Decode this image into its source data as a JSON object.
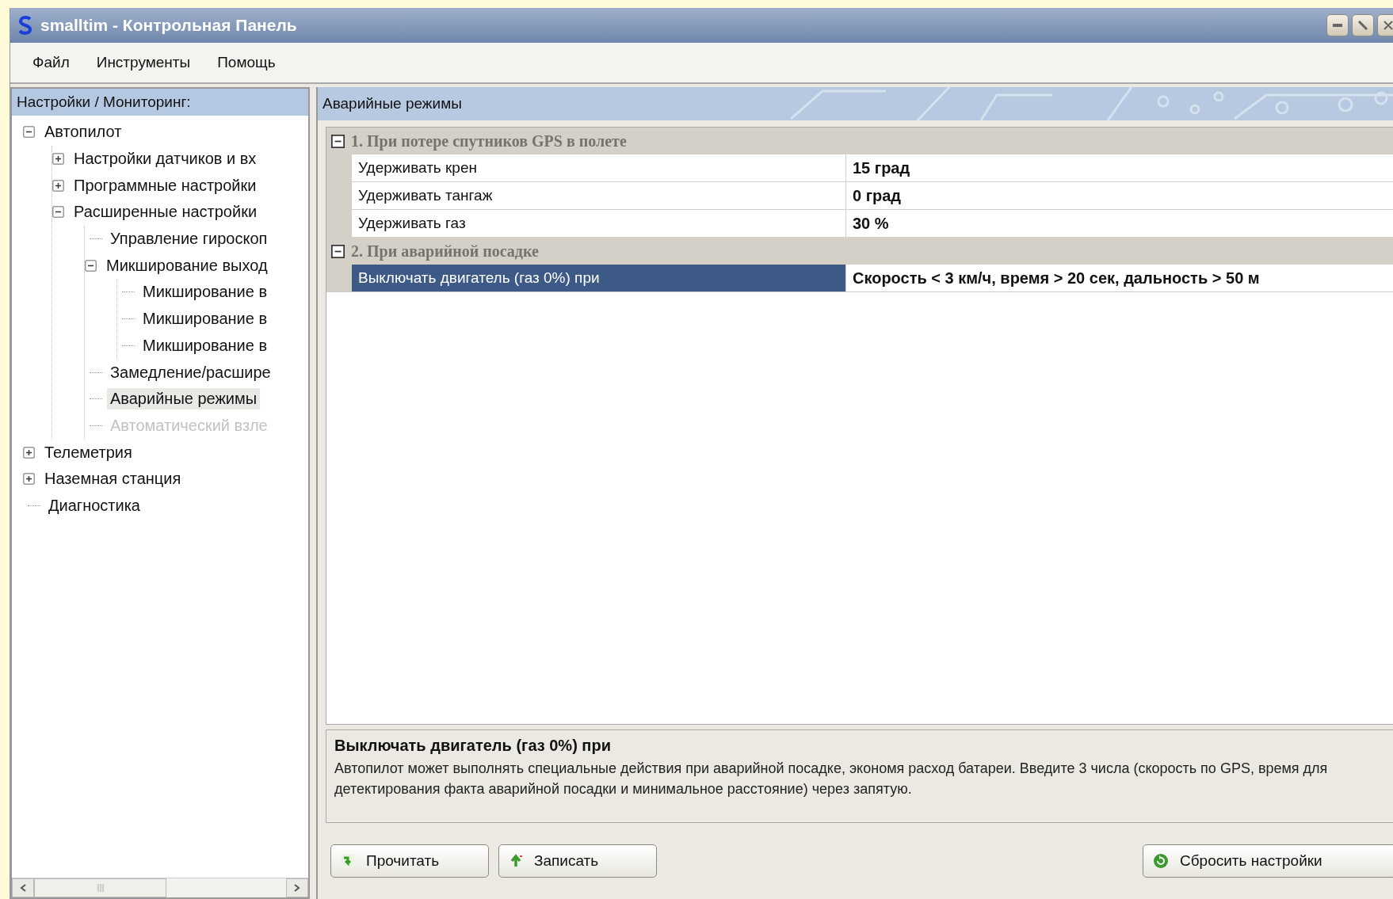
{
  "window": {
    "title": "smalltim - Контрольная Панель"
  },
  "menu": [
    "Файл",
    "Инструменты",
    "Помощь"
  ],
  "tree": {
    "header": "Настройки / Мониторинг:",
    "items": [
      {
        "label": "Автопилот",
        "expanded": true,
        "selected": false,
        "disabled": false,
        "children": [
          {
            "label": "Настройки датчиков и вх",
            "expanded": false,
            "selected": false,
            "disabled": false
          },
          {
            "label": "Программные настройки",
            "expanded": false,
            "selected": false,
            "disabled": false
          },
          {
            "label": "Расширенные настройки",
            "expanded": true,
            "selected": false,
            "disabled": false,
            "children": [
              {
                "label": "Управление гироскоп",
                "selected": false,
                "disabled": false
              },
              {
                "label": "Микширование выход",
                "expanded": true,
                "selected": false,
                "disabled": false,
                "children": [
                  {
                    "label": "Микширование в",
                    "selected": false,
                    "disabled": false
                  },
                  {
                    "label": "Микширование в",
                    "selected": false,
                    "disabled": false
                  },
                  {
                    "label": "Микширование в",
                    "selected": false,
                    "disabled": false
                  }
                ]
              },
              {
                "label": "Замедление/расшире",
                "selected": false,
                "disabled": false
              },
              {
                "label": "Аварийные режимы",
                "selected": true,
                "disabled": false
              },
              {
                "label": "Автоматический взле",
                "selected": false,
                "disabled": true
              }
            ]
          }
        ]
      },
      {
        "label": "Телеметрия",
        "expanded": false,
        "selected": false,
        "disabled": false
      },
      {
        "label": "Наземная станция",
        "expanded": false,
        "selected": false,
        "disabled": false
      },
      {
        "label": "Диагностика",
        "selected": false,
        "disabled": false
      }
    ]
  },
  "panel": {
    "title": "Аварийные режимы",
    "categories": [
      {
        "title": "1. При потере спутников GPS в полете",
        "expanded": true,
        "rows": [
          {
            "name": "Удерживать крен",
            "value": "15 град",
            "selected": false
          },
          {
            "name": "Удерживать тангаж",
            "value": "0 град",
            "selected": false
          },
          {
            "name": "Удерживать газ",
            "value": "30 %",
            "selected": false
          }
        ]
      },
      {
        "title": "2. При аварийной посадке",
        "expanded": true,
        "rows": [
          {
            "name": "Выключать двигатель (газ 0%) при",
            "value": "Скорость < 3 км/ч, время > 20 сек, дальность > 50 м",
            "selected": true
          }
        ]
      }
    ],
    "description": {
      "title": "Выключать двигатель (газ 0%) при",
      "text": "Автопилот может выполнять специальные действия при аварийной посадке, экономя расход батареи. Введите 3 числа (скорость по GPS, время для детектирования факта аварийной посадки и минимальное расстояние) через запятую."
    },
    "buttons": [
      {
        "label": "Прочитать",
        "kind": "read"
      },
      {
        "label": "Записать",
        "kind": "write"
      },
      {
        "label": "Сбросить настройки",
        "kind": "reset"
      }
    ]
  }
}
